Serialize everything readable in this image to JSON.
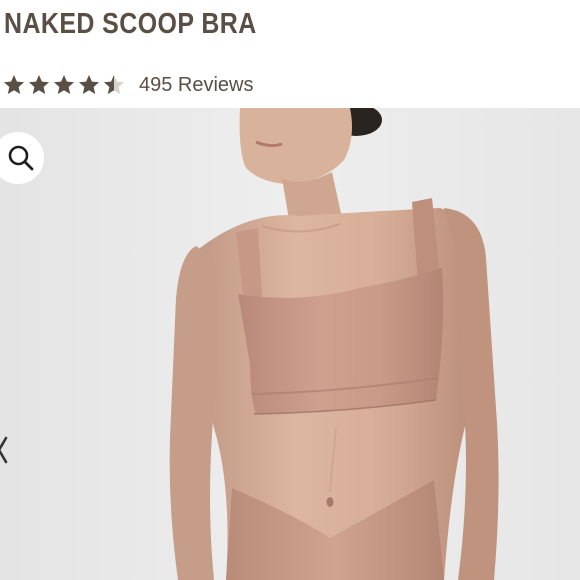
{
  "product": {
    "title": "NAKED SCOOP BRA"
  },
  "rating": {
    "value": 4.5,
    "max": 5,
    "reviews_label": "495 Reviews"
  },
  "gallery": {
    "search_icon": "search-icon",
    "prev_icon": "chevron-left-icon"
  },
  "colors": {
    "text": "#5a4f45",
    "star": "#5a4f45",
    "star_empty": "#d8d3ce",
    "photo_background": "#ebebeb",
    "product_tone": "#cc9f8a"
  }
}
